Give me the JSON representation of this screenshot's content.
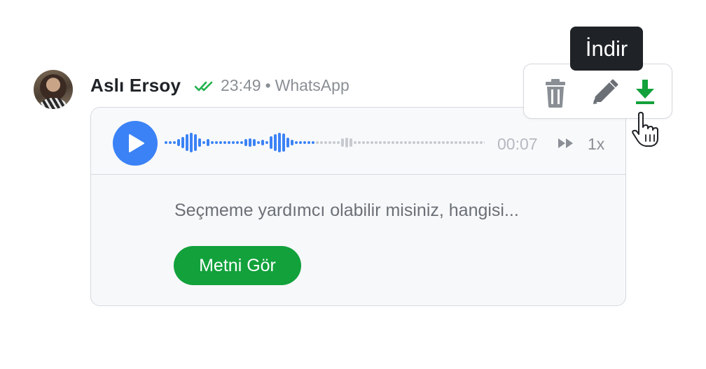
{
  "message": {
    "sender": "Aslı Ersoy",
    "time": "23:49",
    "separator": "•",
    "source": "WhatsApp"
  },
  "player": {
    "duration": "00:07",
    "speed": "1x",
    "progress": 0.47
  },
  "transcript": {
    "preview": "Seçmeme yardımcı olabilir misiniz, hangisi...",
    "button_label": "Metni Gör"
  },
  "toolbar": {
    "tooltip": "İndir",
    "icons": [
      "trash-icon",
      "pencil-icon",
      "download-icon"
    ]
  },
  "colors": {
    "accent_blue": "#3b82f6",
    "accent_green": "#12a13b",
    "tick_green": "#22b14c"
  }
}
